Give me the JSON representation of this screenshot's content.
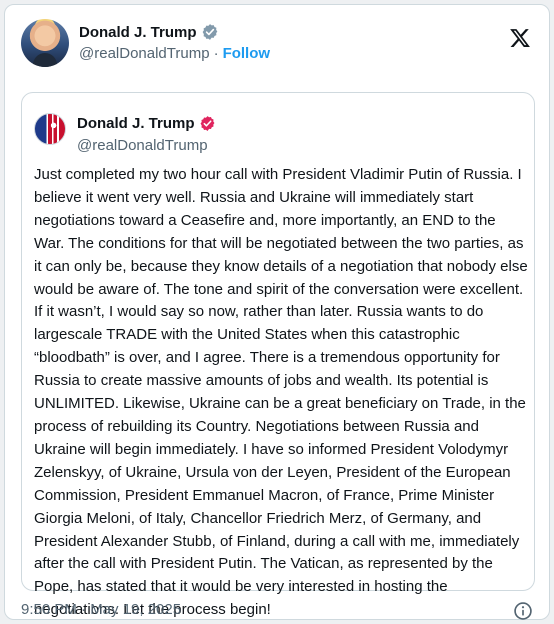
{
  "author": {
    "display_name": "Donald J. Trump",
    "handle": "@realDonaldTrump",
    "separator": "·",
    "follow_label": "Follow"
  },
  "quoted_post": {
    "display_name": "Donald J. Trump",
    "handle": "@realDonaldTrump",
    "text": "Just completed my two hour call with President Vladimir Putin of Russia. I believe it went very well. Russia and Ukraine will immediately start negotiations toward a Ceasefire and, more importantly, an END to the War. The conditions for that will be negotiated between the two parties, as it can only be, because they know details of a negotiation that nobody else would be aware of. The tone and spirit of the conversation were excellent. If it wasn’t, I would say so now, rather than later. Russia wants to do largescale TRADE with the United States when this catastrophic “bloodbath” is over, and I agree. There is a tremendous opportunity for Russia to create massive amounts of jobs and wealth. Its potential is UNLIMITED. Likewise, Ukraine can be a great beneficiary on Trade, in the process of rebuilding its Country. Negotiations between Russia and Ukraine will begin immediately. I have so informed President Volodymyr Zelenskyy, of Ukraine, Ursula von der Leyen, President of the European Commission, President Emmanuel Macron, of France, Prime Minister Giorgia Meloni, of Italy, Chancellor Friedrich Merz, of Germany, and President Alexander Stubb, of Finland, during a call with me, immediately after the call with President Putin. The Vatican, as represented by the Pope, has stated that it would be very interested in hosting the negotiations. Let the process begin!"
  },
  "timestamp": "9:50 PM · May 19, 2025",
  "icons": {
    "verified": "verified-badge-icon",
    "x_logo": "x-logo-icon",
    "info": "info-icon"
  },
  "colors": {
    "accent": "#1d9bf0",
    "verified_gray": "#829aab",
    "verified_pink": "#e0245e",
    "muted_text": "#536471"
  }
}
